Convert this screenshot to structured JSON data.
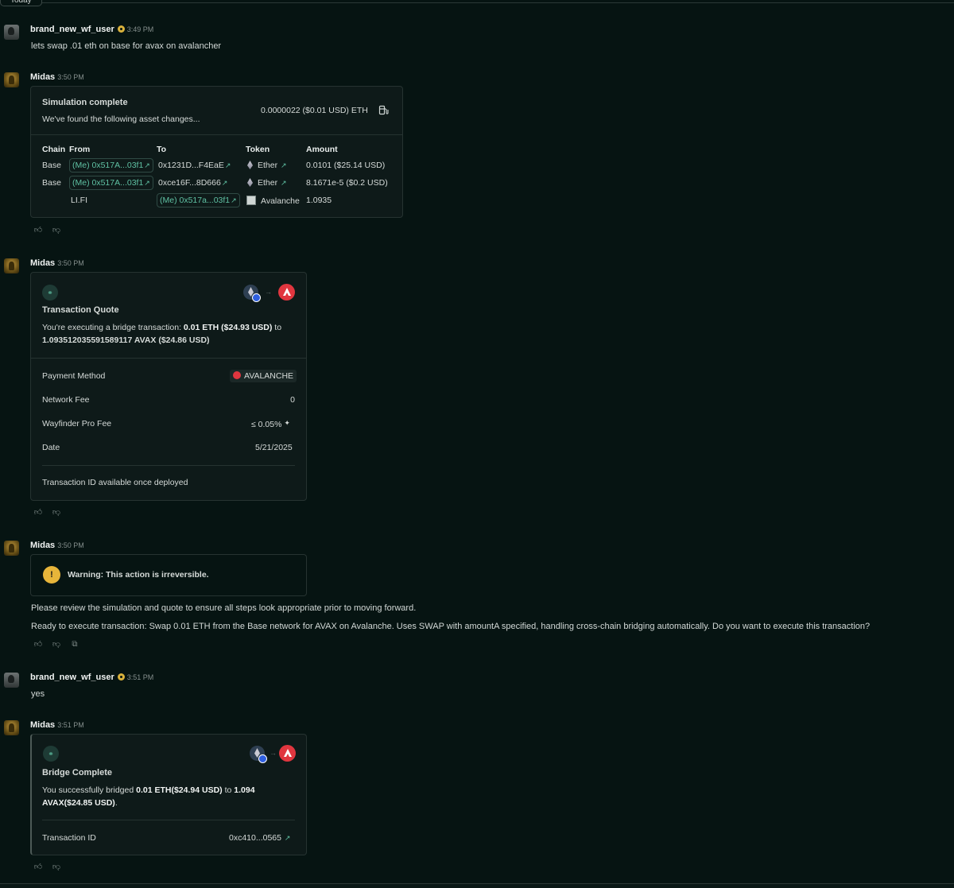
{
  "today_label": "Today",
  "messages": {
    "m1": {
      "user": "brand_new_wf_user",
      "time": "3:49 PM",
      "text": "lets swap .01 eth on base for avax on avalancher"
    },
    "m2": {
      "user": "Midas",
      "time": "3:50 PM",
      "title": "Simulation complete",
      "subtitle": "We've found the following asset changes...",
      "gas": "0.0000022 ($0.01 USD) ETH",
      "gas_icon": "gas-pump-icon",
      "headers": {
        "chain": "Chain",
        "from": "From",
        "to": "To",
        "token": "Token",
        "amount": "Amount"
      },
      "rows": [
        {
          "chain": "Base",
          "from": "(Me) 0x517A...03f1",
          "to": "0x1231D...F4EaE",
          "token": "Ether",
          "amount": "0.0101 ($25.14 USD)"
        },
        {
          "chain": "Base",
          "from": "(Me) 0x517A...03f1",
          "to": "0xce16F...8D666",
          "token": "Ether",
          "amount": "8.1671e-5 ($0.2 USD)"
        },
        {
          "chain": "",
          "from": "LI.FI",
          "to": "(Me) 0x517a...03f1",
          "token": "Avalanche",
          "amount": "1.0935"
        }
      ]
    },
    "m3": {
      "user": "Midas",
      "time": "3:50 PM",
      "title": "Transaction Quote",
      "desc_prefix": "You're executing a bridge transaction: ",
      "desc_eth": "0.01 ETH ($24.93 USD)",
      "desc_mid": " to",
      "desc_avax": "1.093512035591589117 AVAX ($24.86 USD)",
      "payment_label": "Payment Method",
      "payment_value": "AVALANCHE",
      "network_fee_label": "Network Fee",
      "network_fee_value": "0",
      "pro_fee_label": "Wayfinder Pro Fee",
      "pro_fee_value": "≤ 0.05%",
      "date_label": "Date",
      "date_value": "5/21/2025",
      "txid_note": "Transaction ID available once deployed"
    },
    "m4": {
      "user": "Midas",
      "time": "3:50 PM",
      "warning": "Warning: This action is irreversible.",
      "line1": "Please review the simulation and quote to ensure all steps look appropriate prior to moving forward.",
      "line2": "Ready to execute transaction: Swap 0.01 ETH from the Base network for AVAX on Avalanche. Uses SWAP with amountA specified, handling cross-chain bridging automatically. Do you want to execute this transaction?"
    },
    "m5": {
      "user": "brand_new_wf_user",
      "time": "3:51 PM",
      "text": "yes"
    },
    "m6": {
      "user": "Midas",
      "time": "3:51 PM",
      "title": "Bridge Complete",
      "desc_prefix": "You successfully bridged ",
      "desc_eth": "0.01 ETH($24.94 USD)",
      "desc_mid": " to ",
      "desc_avax_1": "1.094",
      "desc_avax_2": "AVAX($24.85 USD)",
      "desc_end": ".",
      "txid_label": "Transaction ID",
      "txid_value": "0xc410...0565"
    }
  }
}
